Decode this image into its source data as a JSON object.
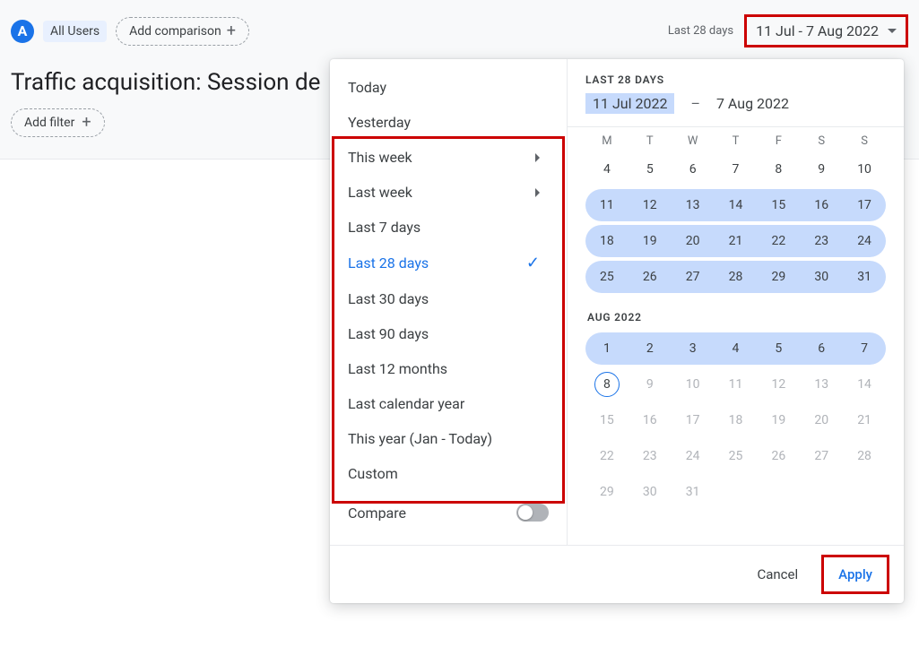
{
  "audience_badge": "A",
  "audience_label": "All Users",
  "add_comparison_label": "Add comparison",
  "date_trigger_label": "Last 28 days",
  "date_trigger_value": "11 Jul - 7 Aug 2022",
  "report_title": "Traffic acquisition: Session de",
  "add_filter_label": "Add filter",
  "presets": {
    "today": "Today",
    "yesterday": "Yesterday",
    "this_week": "This week",
    "last_week": "Last week",
    "last_7": "Last 7 days",
    "last_28": "Last 28 days",
    "last_30": "Last 30 days",
    "last_90": "Last 90 days",
    "last_12m": "Last 12 months",
    "last_cal_year": "Last calendar year",
    "this_year": "This year (Jan - Today)",
    "custom": "Custom",
    "compare": "Compare"
  },
  "range": {
    "header": "LAST 28 DAYS",
    "start": "11 Jul 2022",
    "sep": "–",
    "end": "7 Aug 2022"
  },
  "weekdays": [
    "M",
    "T",
    "W",
    "T",
    "F",
    "S",
    "S"
  ],
  "month2_label": "AUG 2022",
  "jul": {
    "r1": [
      "4",
      "5",
      "6",
      "7",
      "8",
      "9",
      "10"
    ],
    "r2": [
      "11",
      "12",
      "13",
      "14",
      "15",
      "16",
      "17"
    ],
    "r3": [
      "18",
      "19",
      "20",
      "21",
      "22",
      "23",
      "24"
    ],
    "r4": [
      "25",
      "26",
      "27",
      "28",
      "29",
      "30",
      "31"
    ]
  },
  "aug": {
    "r1": [
      "1",
      "2",
      "3",
      "4",
      "5",
      "6",
      "7"
    ],
    "r2": [
      "8",
      "9",
      "10",
      "11",
      "12",
      "13",
      "14"
    ],
    "r3": [
      "15",
      "16",
      "17",
      "18",
      "19",
      "20",
      "21"
    ],
    "r4": [
      "22",
      "23",
      "24",
      "25",
      "26",
      "27",
      "28"
    ],
    "r5": [
      "29",
      "30",
      "31",
      "",
      "",
      "",
      ""
    ]
  },
  "footer": {
    "cancel": "Cancel",
    "apply": "Apply"
  }
}
